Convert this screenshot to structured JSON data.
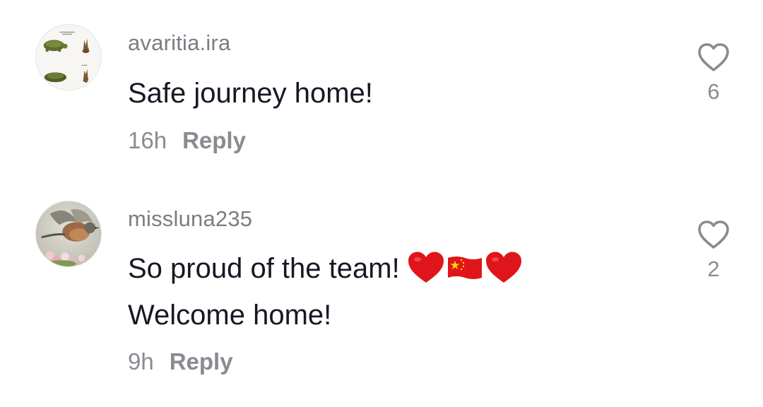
{
  "comments": [
    {
      "username": "avaritia.ira",
      "lines": [
        "Safe journey home!"
      ],
      "time": "16h",
      "reply_label": "Reply",
      "likes": "6",
      "avatar": "turtle-and-rabbit-illustration"
    },
    {
      "username": "missluna235",
      "lines": [
        "So proud of the team!",
        "Welcome home!"
      ],
      "emojis": [
        "red-heart",
        "china-flag",
        "red-heart"
      ],
      "time": "9h",
      "reply_label": "Reply",
      "likes": "2",
      "avatar": "bird-photo"
    }
  ],
  "colors": {
    "username": "#7b7d84",
    "text": "#161823",
    "meta": "#8a8b91",
    "heart_outline": "#8a8b91",
    "emoji_heart": "#e0151c",
    "flag_red": "#e0151c",
    "flag_star": "#ffde00"
  }
}
